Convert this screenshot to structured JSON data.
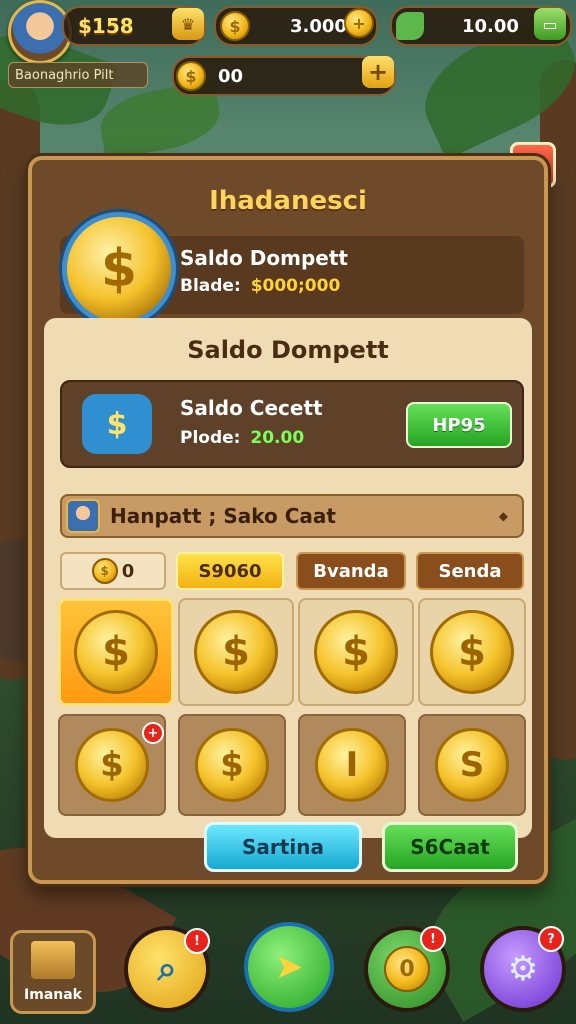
{
  "hud": {
    "cash": "$158",
    "gold": "3.0000",
    "gems": "10.00",
    "coins": "00",
    "player_name": "Baonaghrio Pilt"
  },
  "panel": {
    "title": "Ihadanesci",
    "wallet_label": "Saldo Dompett",
    "wallet_balance_label": "Blade:",
    "wallet_balance_value": "$000;000",
    "section_title": "Saldo Dompett",
    "bank_label": "Saldo Cecett",
    "bank_balance_label": "Plode:",
    "bank_balance_value": "20.00",
    "bank_button": "HP95",
    "user_row_text": "Hanpatt ; Sako Caat",
    "tabs": [
      {
        "label": "0"
      },
      {
        "label": "S9060"
      },
      {
        "label": "Bvanda"
      },
      {
        "label": "Senda"
      }
    ],
    "coins_row1": [
      "$",
      "$",
      "$",
      "$"
    ],
    "coins_row2": [
      "$",
      "$",
      "I",
      "S"
    ],
    "btn_secondary": "Sartina",
    "btn_primary": "S6Caat"
  },
  "bottom_nav": {
    "shop_label": "Imanak",
    "badge_1": "!",
    "badge_2": "!",
    "badge_3": "?"
  },
  "colors": {
    "gold": "#f4c12a",
    "panel": "#6e4a2a",
    "accent_green": "#25a422",
    "accent_cyan": "#1db7d8",
    "close_red": "#d8321a"
  }
}
